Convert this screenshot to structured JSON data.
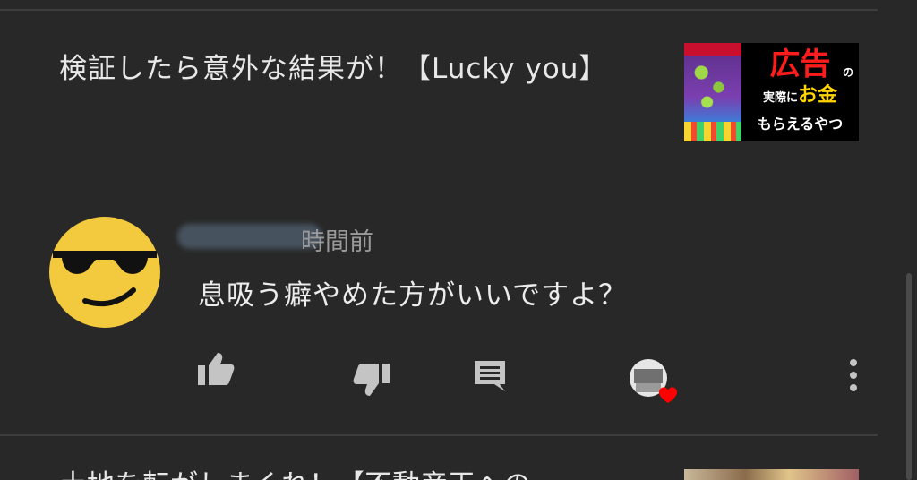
{
  "video": {
    "title": "検証したら意外な結果が！【Lucky you】",
    "thumbnail": {
      "ad_big": "広告",
      "ad_no": "の",
      "ad_line2_prefix": "実際に",
      "ad_line2_money": "お金",
      "ad_line3": "もらえるやつ"
    }
  },
  "comment": {
    "time_suffix": "時間前",
    "text": "息吸う癖やめた方がいいですよ？",
    "avatar_icon": "sunglasses-face-emoji"
  },
  "actions": {
    "like_icon": "thumb-up-icon",
    "dislike_icon": "thumb-down-icon",
    "reply_icon": "comment-icon",
    "creator_heart_icon": "creator-heart-icon",
    "more_icon": "more-vertical-icon"
  },
  "next_video": {
    "title_partial": "土地を転がしまくれ！【不動産王への"
  },
  "colors": {
    "background": "#282828",
    "divider": "#3d3d3d",
    "heart": "#ff0000",
    "emoji_face": "#f3c93e"
  }
}
